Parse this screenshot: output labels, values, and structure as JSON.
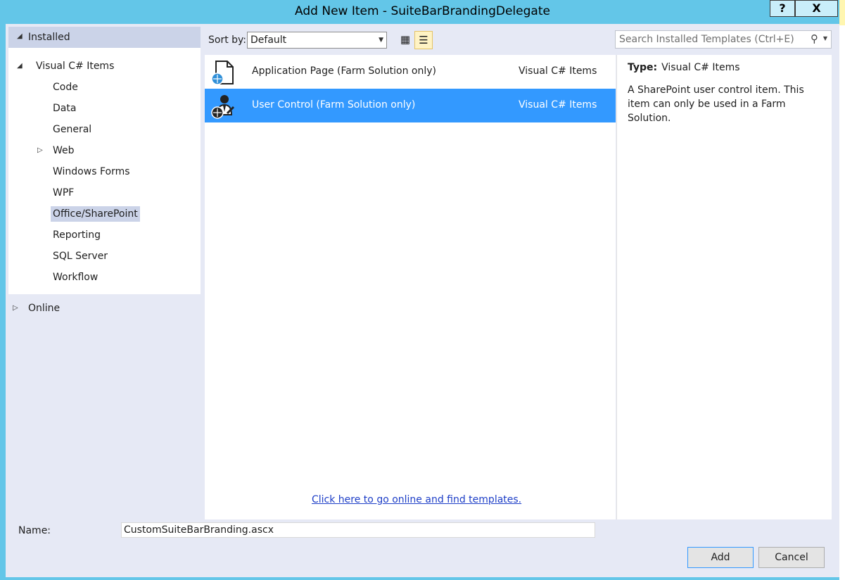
{
  "window": {
    "title": "Add New Item - SuiteBarBrandingDelegate",
    "help_label": "?",
    "close_label": "X"
  },
  "tree": {
    "installed": "Installed",
    "root": "Visual C# Items",
    "children": [
      "Code",
      "Data",
      "General",
      "Web",
      "Windows Forms",
      "WPF",
      "Office/SharePoint",
      "Reporting",
      "SQL Server",
      "Workflow"
    ],
    "selected": "Office/SharePoint",
    "online": "Online"
  },
  "sortbar": {
    "label": "Sort by:",
    "value": "Default"
  },
  "items": [
    {
      "name": "Application Page (Farm Solution only)",
      "category": "Visual C# Items",
      "icon": "application-page-icon",
      "selected": false
    },
    {
      "name": "User Control (Farm Solution only)",
      "category": "Visual C# Items",
      "icon": "user-control-icon",
      "selected": true
    }
  ],
  "online_link": "Click here to go online and find templates.",
  "search": {
    "placeholder": "Search Installed Templates (Ctrl+E)"
  },
  "info": {
    "type_label": "Type:",
    "type_value": "Visual C# Items",
    "description": "A SharePoint user control item. This item can only be used in a Farm Solution."
  },
  "footer": {
    "name_label": "Name:",
    "name_value": "CustomSuiteBarBranding.ascx",
    "add_label": "Add",
    "cancel_label": "Cancel"
  },
  "colors": {
    "title_bar": "#63c6e8",
    "selection": "#3399ff",
    "link": "#1d3ec7"
  }
}
